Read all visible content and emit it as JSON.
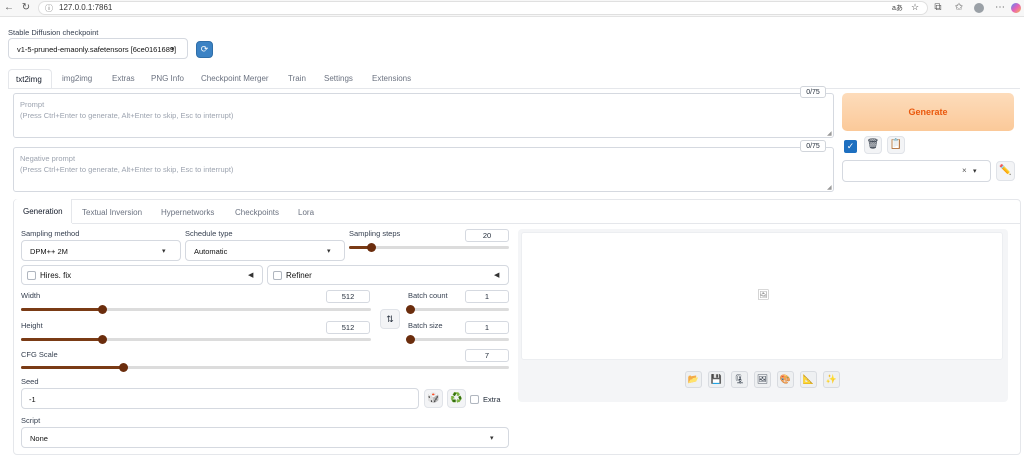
{
  "browser": {
    "url": "127.0.0.1:7861",
    "translate_label": "aあ"
  },
  "checkpoint": {
    "label": "Stable Diffusion checkpoint",
    "value": "v1-5-pruned-emaonly.safetensors [6ce0161689]"
  },
  "main_tabs": [
    "txt2img",
    "img2img",
    "Extras",
    "PNG Info",
    "Checkpoint Merger",
    "Train",
    "Settings",
    "Extensions"
  ],
  "prompt": {
    "label": "Prompt",
    "placeholder": "(Press Ctrl+Enter to generate, Alt+Enter to skip, Esc to interrupt)",
    "counter": "0/75"
  },
  "negative_prompt": {
    "label": "Negative prompt",
    "placeholder": "(Press Ctrl+Enter to generate, Alt+Enter to skip, Esc to interrupt)",
    "counter": "0/75"
  },
  "generate_label": "Generate",
  "styles_clear": "×",
  "sub_tabs": [
    "Generation",
    "Textual Inversion",
    "Hypernetworks",
    "Checkpoints",
    "Lora"
  ],
  "sampling_method": {
    "label": "Sampling method",
    "value": "DPM++ 2M"
  },
  "schedule_type": {
    "label": "Schedule type",
    "value": "Automatic"
  },
  "sampling_steps": {
    "label": "Sampling steps",
    "value": "20",
    "fraction": 0.14
  },
  "hires_fix_label": "Hires. fix",
  "refiner_label": "Refiner",
  "width": {
    "label": "Width",
    "value": "512",
    "fraction": 0.23
  },
  "height": {
    "label": "Height",
    "value": "512",
    "fraction": 0.23
  },
  "batch_count": {
    "label": "Batch count",
    "value": "1",
    "fraction": 0.02
  },
  "batch_size": {
    "label": "Batch size",
    "value": "1",
    "fraction": 0.02
  },
  "cfg_scale": {
    "label": "CFG Scale",
    "value": "7",
    "fraction": 0.21
  },
  "seed": {
    "label": "Seed",
    "value": "-1"
  },
  "extra_label": "Extra",
  "script": {
    "label": "Script",
    "value": "None"
  },
  "colors": {
    "accent": "#6b2d0d",
    "generate_bg": "#fcd8b3",
    "generate_text": "#ea580c"
  }
}
